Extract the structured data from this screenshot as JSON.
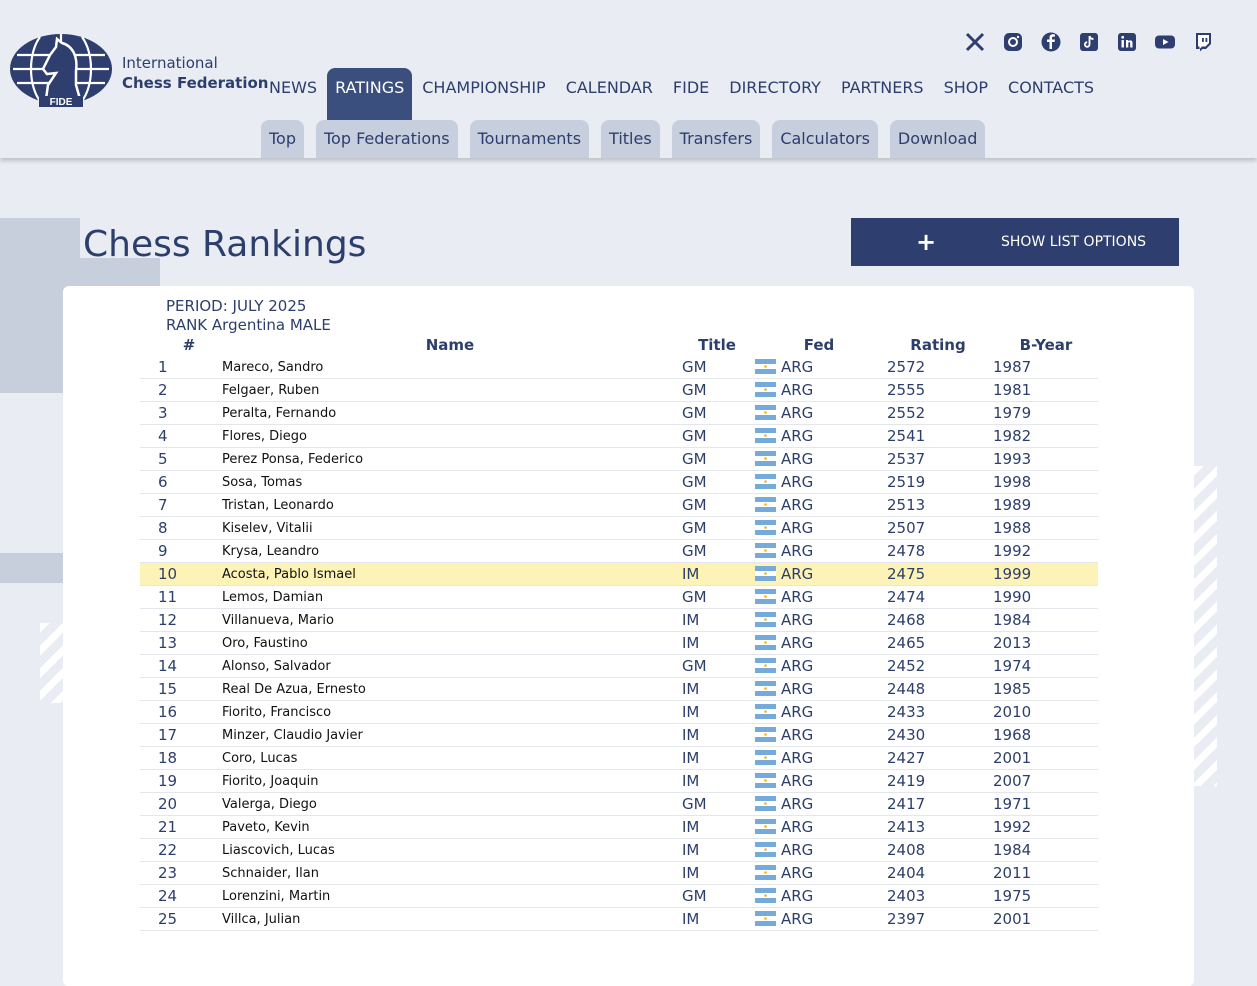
{
  "brand": {
    "line1": "International",
    "line2": "Chess Federation",
    "logo_text": "FIDE"
  },
  "social": [
    "x-icon",
    "instagram-icon",
    "facebook-icon",
    "tiktok-icon",
    "linkedin-icon",
    "youtube-icon",
    "twitch-icon"
  ],
  "nav": [
    "NEWS",
    "RATINGS",
    "CHAMPIONSHIP",
    "CALENDAR",
    "FIDE",
    "DIRECTORY",
    "PARTNERS",
    "SHOP",
    "CONTACTS"
  ],
  "nav_active": "RATINGS",
  "subnav": [
    "Top",
    "Top Federations",
    "Tournaments",
    "Titles",
    "Transfers",
    "Calculators",
    "Download"
  ],
  "page_title": "Chess Rankings",
  "options_button": {
    "icon": "+",
    "label": "SHOW LIST OPTIONS"
  },
  "period": "PERIOD: JULY 2025",
  "rank_label": "RANK Argentina MALE",
  "columns": {
    "rank": "#",
    "name": "Name",
    "title": "Title",
    "fed": "Fed",
    "rating": "Rating",
    "byear": "B-Year"
  },
  "highlighted_row": 10,
  "rows": [
    {
      "rank": "1",
      "name": "Mareco, Sandro",
      "title": "GM",
      "fed": "ARG",
      "rating": "2572",
      "byear": "1987"
    },
    {
      "rank": "2",
      "name": "Felgaer, Ruben",
      "title": "GM",
      "fed": "ARG",
      "rating": "2555",
      "byear": "1981"
    },
    {
      "rank": "3",
      "name": "Peralta, Fernando",
      "title": "GM",
      "fed": "ARG",
      "rating": "2552",
      "byear": "1979"
    },
    {
      "rank": "4",
      "name": "Flores, Diego",
      "title": "GM",
      "fed": "ARG",
      "rating": "2541",
      "byear": "1982"
    },
    {
      "rank": "5",
      "name": "Perez Ponsa, Federico",
      "title": "GM",
      "fed": "ARG",
      "rating": "2537",
      "byear": "1993"
    },
    {
      "rank": "6",
      "name": "Sosa, Tomas",
      "title": "GM",
      "fed": "ARG",
      "rating": "2519",
      "byear": "1998"
    },
    {
      "rank": "7",
      "name": "Tristan, Leonardo",
      "title": "GM",
      "fed": "ARG",
      "rating": "2513",
      "byear": "1989"
    },
    {
      "rank": "8",
      "name": "Kiselev, Vitalii",
      "title": "GM",
      "fed": "ARG",
      "rating": "2507",
      "byear": "1988"
    },
    {
      "rank": "9",
      "name": "Krysa, Leandro",
      "title": "GM",
      "fed": "ARG",
      "rating": "2478",
      "byear": "1992"
    },
    {
      "rank": "10",
      "name": "Acosta, Pablo Ismael",
      "title": "IM",
      "fed": "ARG",
      "rating": "2475",
      "byear": "1999"
    },
    {
      "rank": "11",
      "name": "Lemos, Damian",
      "title": "GM",
      "fed": "ARG",
      "rating": "2474",
      "byear": "1990"
    },
    {
      "rank": "12",
      "name": "Villanueva, Mario",
      "title": "IM",
      "fed": "ARG",
      "rating": "2468",
      "byear": "1984"
    },
    {
      "rank": "13",
      "name": "Oro, Faustino",
      "title": "IM",
      "fed": "ARG",
      "rating": "2465",
      "byear": "2013"
    },
    {
      "rank": "14",
      "name": "Alonso, Salvador",
      "title": "GM",
      "fed": "ARG",
      "rating": "2452",
      "byear": "1974"
    },
    {
      "rank": "15",
      "name": "Real De Azua, Ernesto",
      "title": "IM",
      "fed": "ARG",
      "rating": "2448",
      "byear": "1985"
    },
    {
      "rank": "16",
      "name": "Fiorito, Francisco",
      "title": "IM",
      "fed": "ARG",
      "rating": "2433",
      "byear": "2010"
    },
    {
      "rank": "17",
      "name": "Minzer, Claudio Javier",
      "title": "IM",
      "fed": "ARG",
      "rating": "2430",
      "byear": "1968"
    },
    {
      "rank": "18",
      "name": "Coro, Lucas",
      "title": "IM",
      "fed": "ARG",
      "rating": "2427",
      "byear": "2001"
    },
    {
      "rank": "19",
      "name": "Fiorito, Joaquin",
      "title": "IM",
      "fed": "ARG",
      "rating": "2419",
      "byear": "2007"
    },
    {
      "rank": "20",
      "name": "Valerga, Diego",
      "title": "GM",
      "fed": "ARG",
      "rating": "2417",
      "byear": "1971"
    },
    {
      "rank": "21",
      "name": "Paveto, Kevin",
      "title": "IM",
      "fed": "ARG",
      "rating": "2413",
      "byear": "1992"
    },
    {
      "rank": "22",
      "name": "Liascovich, Lucas",
      "title": "IM",
      "fed": "ARG",
      "rating": "2408",
      "byear": "1984"
    },
    {
      "rank": "23",
      "name": "Schnaider, Ilan",
      "title": "IM",
      "fed": "ARG",
      "rating": "2404",
      "byear": "2011"
    },
    {
      "rank": "24",
      "name": "Lorenzini, Martin",
      "title": "GM",
      "fed": "ARG",
      "rating": "2403",
      "byear": "1975"
    },
    {
      "rank": "25",
      "name": "Villca, Julian",
      "title": "IM",
      "fed": "ARG",
      "rating": "2397",
      "byear": "2001"
    }
  ],
  "colors": {
    "navy": "#2e3e6e",
    "active_tab": "#3b4f7f",
    "subtab": "#c7cedd",
    "highlight": "#fdf3b6",
    "background": "#e9edf3",
    "flag_blue": "#75aadb"
  }
}
